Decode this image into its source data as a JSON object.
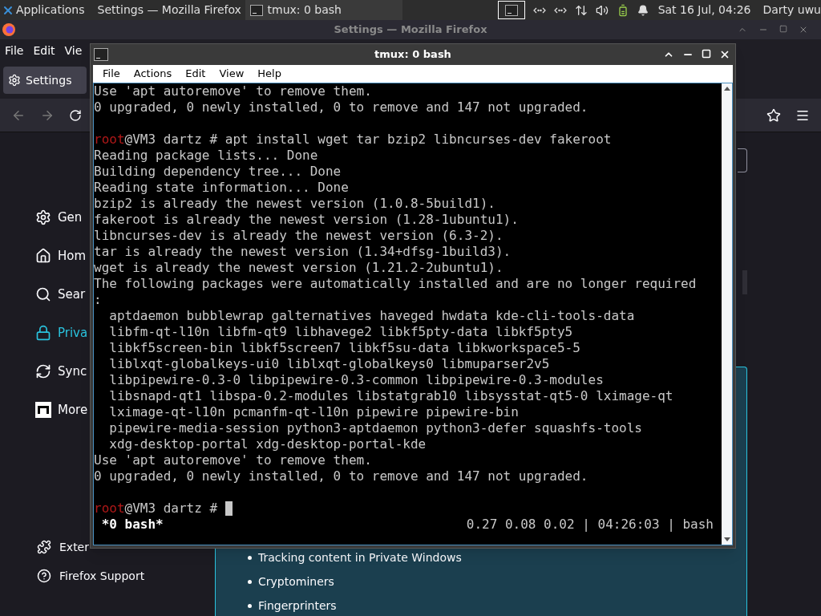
{
  "taskbar": {
    "apps_menu": "Applications",
    "tasks": [
      {
        "label": "Settings — Mozilla Firefox",
        "selected": false
      },
      {
        "label": "tmux: 0 bash",
        "selected": true
      }
    ],
    "clock": "Sat 16 Jul, 04:26",
    "user": "Darty uwu"
  },
  "firefox": {
    "title": "Settings — Mozilla Firefox",
    "menu": [
      "File",
      "Edit",
      "Vie"
    ],
    "tab": "Settings",
    "sidebar": [
      {
        "label": "Gen",
        "selected": false
      },
      {
        "label": "Hom",
        "selected": false
      },
      {
        "label": "Sear",
        "selected": false
      },
      {
        "label": "Priva",
        "selected": true
      },
      {
        "label": "Sync",
        "selected": false
      },
      {
        "label": "More",
        "selected": false
      }
    ],
    "footer": [
      "Exter",
      "Firefox Support"
    ],
    "blocked_list": [
      "Tracking content in Private Windows",
      "Cryptominers",
      "Fingerprinters"
    ]
  },
  "terminal": {
    "title": "tmux: 0 bash",
    "menu": [
      "File",
      "Actions",
      "Edit",
      "View",
      "Help"
    ],
    "lines": [
      {
        "kind": "text",
        "text": "Use 'apt autoremove' to remove them."
      },
      {
        "kind": "text",
        "text": "0 upgraded, 0 newly installed, 0 to remove and 147 not upgraded."
      },
      {
        "kind": "blank"
      },
      {
        "kind": "prompt",
        "user": "root",
        "rest": "@VM3 dartz # apt install wget tar bzip2 libncurses-dev fakeroot",
        "cursor": false
      },
      {
        "kind": "text",
        "text": "Reading package lists... Done"
      },
      {
        "kind": "text",
        "text": "Building dependency tree... Done"
      },
      {
        "kind": "text",
        "text": "Reading state information... Done"
      },
      {
        "kind": "text",
        "text": "bzip2 is already the newest version (1.0.8-5build1)."
      },
      {
        "kind": "text",
        "text": "fakeroot is already the newest version (1.28-1ubuntu1)."
      },
      {
        "kind": "text",
        "text": "libncurses-dev is already the newest version (6.3-2)."
      },
      {
        "kind": "text",
        "text": "tar is already the newest version (1.34+dfsg-1build3)."
      },
      {
        "kind": "text",
        "text": "wget is already the newest version (1.21.2-2ubuntu1)."
      },
      {
        "kind": "text",
        "text": "The following packages were automatically installed and are no longer required"
      },
      {
        "kind": "text",
        "text": ":"
      },
      {
        "kind": "text",
        "text": "  aptdaemon bubblewrap galternatives haveged hwdata kde-cli-tools-data"
      },
      {
        "kind": "text",
        "text": "  libfm-qt-l10n libfm-qt9 libhavege2 libkf5pty-data libkf5pty5"
      },
      {
        "kind": "text",
        "text": "  libkf5screen-bin libkf5screen7 libkf5su-data libkworkspace5-5"
      },
      {
        "kind": "text",
        "text": "  liblxqt-globalkeys-ui0 liblxqt-globalkeys0 libmuparser2v5"
      },
      {
        "kind": "text",
        "text": "  libpipewire-0.3-0 libpipewire-0.3-common libpipewire-0.3-modules"
      },
      {
        "kind": "text",
        "text": "  libsnapd-qt1 libspa-0.2-modules libstatgrab10 libsysstat-qt5-0 lximage-qt"
      },
      {
        "kind": "text",
        "text": "  lximage-qt-l10n pcmanfm-qt-l10n pipewire pipewire-bin"
      },
      {
        "kind": "text",
        "text": "  pipewire-media-session python3-aptdaemon python3-defer squashfs-tools"
      },
      {
        "kind": "text",
        "text": "  xdg-desktop-portal xdg-desktop-portal-kde"
      },
      {
        "kind": "text",
        "text": "Use 'apt autoremove' to remove them."
      },
      {
        "kind": "text",
        "text": "0 upgraded, 0 newly installed, 0 to remove and 147 not upgraded."
      },
      {
        "kind": "blank"
      },
      {
        "kind": "prompt",
        "user": "root",
        "rest": "@VM3 dartz # ",
        "cursor": true
      }
    ],
    "status_left": " *0 bash*",
    "status_right": "0.27 0.08 0.02 | 04:26:03 | bash"
  }
}
